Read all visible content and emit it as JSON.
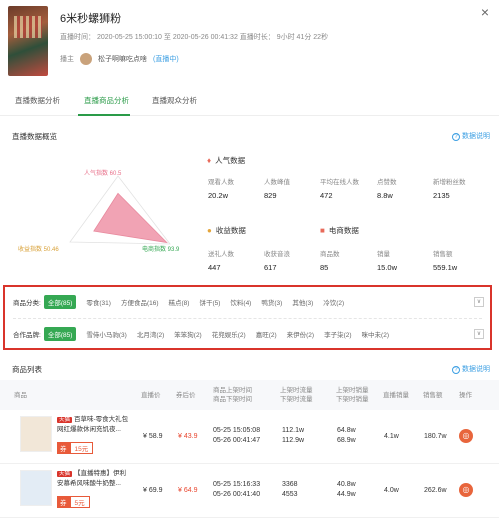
{
  "header": {
    "title": "6米秒螺狮粉",
    "meta": "直播时间：  2020-05-25 15:00:10 至 2020-05-26 00:41:32 直播时长：  9小时 41分 22秒",
    "host_label": "播主",
    "host_name": "松子啊嘛吃点啥",
    "live_tag": "(直播中)",
    "close": "×"
  },
  "tabs": [
    "直播数据分析",
    "直播商品分析",
    "直播观众分析"
  ],
  "overview": {
    "title": "直播数据概览",
    "help": "数据说明",
    "radar": {
      "popularity": "人气指数 60.5",
      "revenue": "收益指数 50.46",
      "commerce": "电商指数 93.9",
      "values": {
        "popularity": 60.5,
        "revenue": 50.46,
        "commerce": 93.9
      },
      "fill_color": "#f1a3b4"
    },
    "popularity": {
      "title": "人气数据",
      "labels": [
        "观看人数",
        "人数峰值",
        "平均在线人数",
        "点赞数",
        "新增粉丝数"
      ],
      "values": [
        "20.2w",
        "829",
        "472",
        "8.8w",
        "2135"
      ]
    },
    "revenue": {
      "title": "收益数据",
      "labels": [
        "送礼人数",
        "收获音浪"
      ],
      "values": [
        "447",
        "617"
      ]
    },
    "commerce": {
      "title": "电商数据",
      "labels": [
        "商品数",
        "销量",
        "销售额"
      ],
      "values": [
        "85",
        "15.0w",
        "559.1w"
      ]
    }
  },
  "filters": {
    "category_label": "商品分类:",
    "categories": [
      "全部(85)",
      "零食(31)",
      "方便食品(16)",
      "糕点(8)",
      "饼干(5)",
      "饮料(4)",
      "鸭货(3)",
      "其他(3)",
      "冷饮(2)"
    ],
    "brand_label": "合作品牌:",
    "brands": [
      "全部(85)",
      "雪侍小马驹(3)",
      "北月湾(2)",
      "笨笨狗(2)",
      "花兜娱乐(2)",
      "嘉旺(2)",
      "来伊份(2)",
      "李子柒(2)",
      "咪中未(2)"
    ],
    "collapse": "∨"
  },
  "products": {
    "title": "商品列表",
    "help": "数据说明",
    "headers": {
      "product": "商品",
      "price": "直播价",
      "coupon_price": "券后价",
      "time_up": "商品上架时间",
      "time_down": "商品下架时间",
      "views_up": "上架时流量",
      "views_down": "下架时流量",
      "sales_up": "上架时销量",
      "sales_down": "下架时销量",
      "live_sales": "直播销量",
      "revenue": "销售额",
      "op": "操作"
    },
    "rows": [
      {
        "tag": "天猫",
        "name": "百草味-零食大礼包网红爆款休闲充饥夜...",
        "coupon_k": "券",
        "coupon_v": "15元",
        "price": "¥ 58.9",
        "coupon_price": "¥ 43.9",
        "time_up": "05-25 15:05:08",
        "time_down": "05-26 00:41:47",
        "views_up": "112.1w",
        "views_down": "112.9w",
        "sales_up": "64.8w",
        "sales_down": "68.9w",
        "live_sales": "4.1w",
        "revenue": "180.7w"
      },
      {
        "tag": "天猫",
        "name": "【直播特惠】伊利安慕希风味酸牛奶整...",
        "coupon_k": "券",
        "coupon_v": "5元",
        "price": "¥ 69.9",
        "coupon_price": "¥ 64.9",
        "time_up": "05-25 15:16:33",
        "time_down": "05-26 00:41:40",
        "views_up": "3368",
        "views_down": "4553",
        "sales_up": "40.8w",
        "sales_down": "44.9w",
        "live_sales": "4.0w",
        "revenue": "262.6w"
      }
    ]
  }
}
